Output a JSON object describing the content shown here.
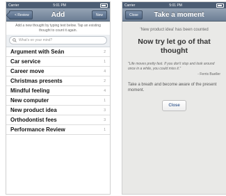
{
  "status_left": {
    "carrier": "Carrier",
    "time": "5:01 PM"
  },
  "status_right": {
    "carrier": "Carrier",
    "time": "5:01 PM"
  },
  "left": {
    "back_label": "< Review",
    "title": "Add",
    "new_label": "New",
    "instructions": "Add a new thought by typing text below. Tap an existing thought to count it again.",
    "search_placeholder": "What's on your mind?",
    "items": [
      {
        "label": "Argument with Seán",
        "count": "2"
      },
      {
        "label": "Car service",
        "count": "1"
      },
      {
        "label": "Career move",
        "count": "4"
      },
      {
        "label": "Christmas presents",
        "count": "2"
      },
      {
        "label": "Mindful feeling",
        "count": "4"
      },
      {
        "label": "New computer",
        "count": "1"
      },
      {
        "label": "New product idea",
        "count": "3"
      },
      {
        "label": "Orthodontist fees",
        "count": "3"
      },
      {
        "label": "Performance Review",
        "count": "1"
      }
    ]
  },
  "right": {
    "close_nav_label": "Close",
    "title": "Take a moment",
    "counted_text": "'New product idea' has been counted",
    "headline": "Now try let go of that thought",
    "quote": "\"Life moves pretty fast. If you don't stop and look around once in a while, you could miss it.\"",
    "attribution": "- Ferris Bueller",
    "breath_text": "Take a breath and become aware of the present moment.",
    "close_button_label": "Close"
  },
  "colors": {
    "navbar": "#7a8ba1",
    "statusbar": "#4c5d73",
    "right_background": "#e9e9e7"
  }
}
